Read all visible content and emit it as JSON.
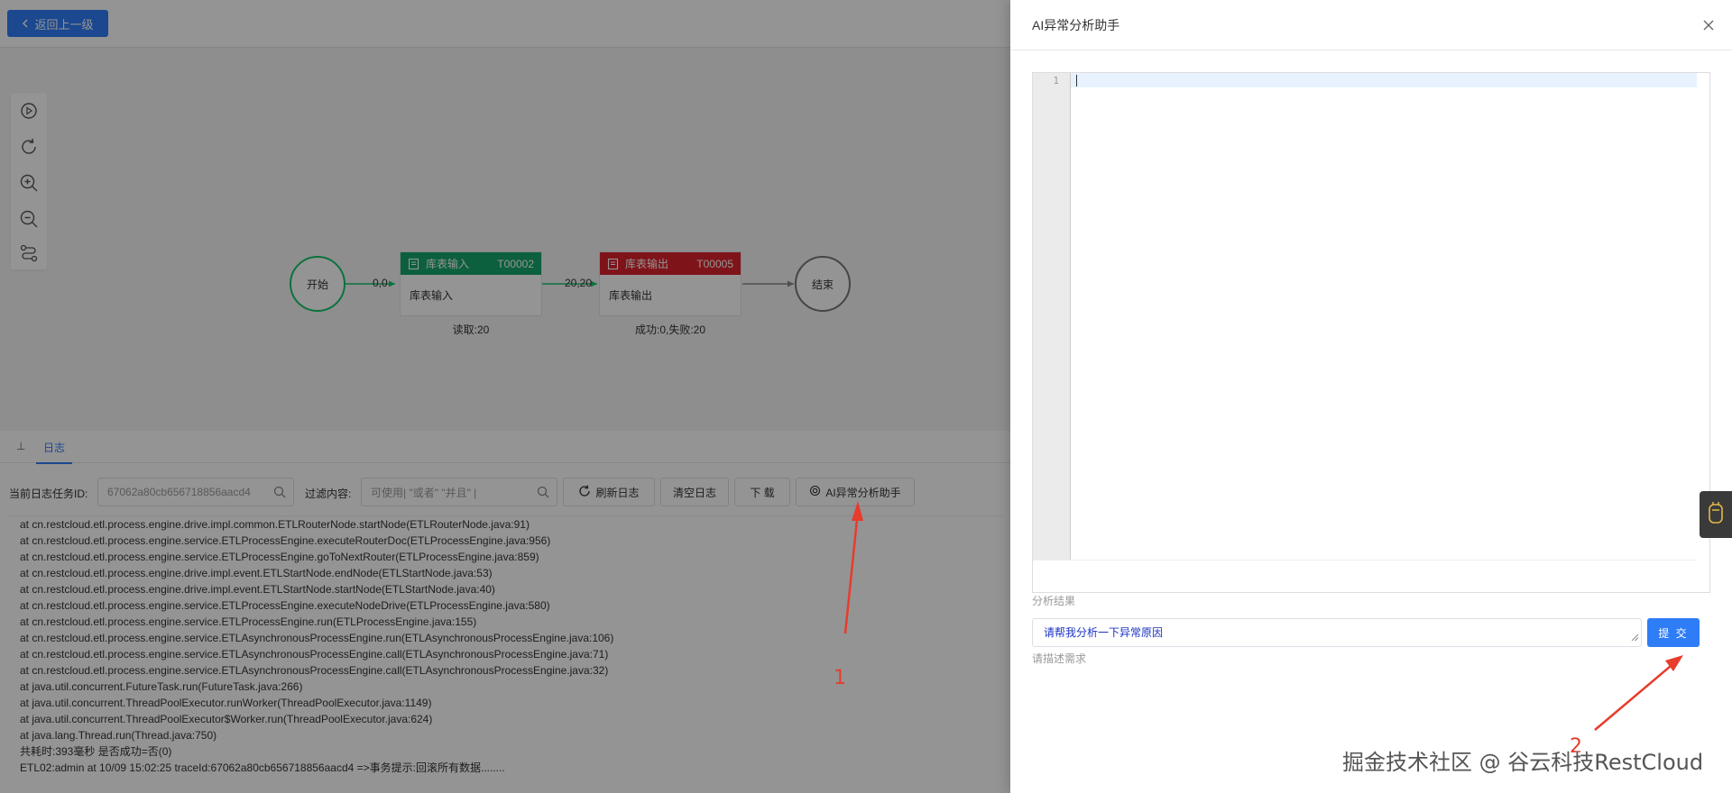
{
  "topbar": {
    "back_label": "返回上一级"
  },
  "flow": {
    "start": "开始",
    "end": "结束",
    "input_node": {
      "head": "库表输入",
      "code": "T00002",
      "body": "库表输入",
      "caption": "读取:20",
      "head_color": "#16a56a"
    },
    "output_node": {
      "head": "库表输出",
      "code": "T00005",
      "body": "库表输出",
      "caption": "成功:0,失败:20",
      "head_color": "#d9242e"
    },
    "edge1_label": "0,0",
    "edge2_label": "20,20",
    "start_color": "#16c46a"
  },
  "log_tabs": {
    "tab1": "⊥",
    "tab2": "日志"
  },
  "log_toolbar": {
    "task_id_label": "当前日志任务ID:",
    "task_id_value": "67062a80cb656718856aacd4",
    "filter_label": "过滤内容:",
    "filter_placeholder": "可使用| \"或者\" \"并且\" |",
    "refresh_label": "刷新日志",
    "clear_label": "清空日志",
    "download_label": "下 载",
    "ai_label": "AI异常分析助手"
  },
  "log_lines": [
    "at cn.restcloud.etl.process.engine.drive.impl.common.ETLRouterNode.startNode(ETLRouterNode.java:91)",
    "at cn.restcloud.etl.process.engine.service.ETLProcessEngine.executeRouterDoc(ETLProcessEngine.java:956)",
    "at cn.restcloud.etl.process.engine.service.ETLProcessEngine.goToNextRouter(ETLProcessEngine.java:859)",
    "at cn.restcloud.etl.process.engine.drive.impl.event.ETLStartNode.endNode(ETLStartNode.java:53)",
    "at cn.restcloud.etl.process.engine.drive.impl.event.ETLStartNode.startNode(ETLStartNode.java:40)",
    "at cn.restcloud.etl.process.engine.service.ETLProcessEngine.executeNodeDrive(ETLProcessEngine.java:580)",
    "at cn.restcloud.etl.process.engine.service.ETLProcessEngine.run(ETLProcessEngine.java:155)",
    "at cn.restcloud.etl.process.engine.service.ETLAsynchronousProcessEngine.run(ETLAsynchronousProcessEngine.java:106)",
    "at cn.restcloud.etl.process.engine.service.ETLAsynchronousProcessEngine.call(ETLAsynchronousProcessEngine.java:71)",
    "at cn.restcloud.etl.process.engine.service.ETLAsynchronousProcessEngine.call(ETLAsynchronousProcessEngine.java:32)",
    "at java.util.concurrent.FutureTask.run(FutureTask.java:266)",
    "at java.util.concurrent.ThreadPoolExecutor.runWorker(ThreadPoolExecutor.java:1149)",
    "at java.util.concurrent.ThreadPoolExecutor$Worker.run(ThreadPoolExecutor.java:624)",
    "at java.lang.Thread.run(Thread.java:750)",
    "共耗时:393毫秒 是否成功=否(0)",
    "ETL02:admin at 10/09 15:02:25 traceId:67062a80cb656718856aacd4 =>事务提示:回滚所有数据........"
  ],
  "drawer": {
    "title": "AI异常分析助手",
    "line_number": "1",
    "result_label": "分析结果",
    "prompt_value": "请帮我分析一下异常原因",
    "submit_label": "提 交",
    "prompt_hint": "请描述需求"
  },
  "annotations": {
    "num1": "1",
    "num2": "2",
    "arrow_color": "#e83c2c"
  },
  "watermark": "掘金技术社区 @ 谷云科技RestCloud",
  "colors": {
    "primary": "#2f7df6"
  }
}
